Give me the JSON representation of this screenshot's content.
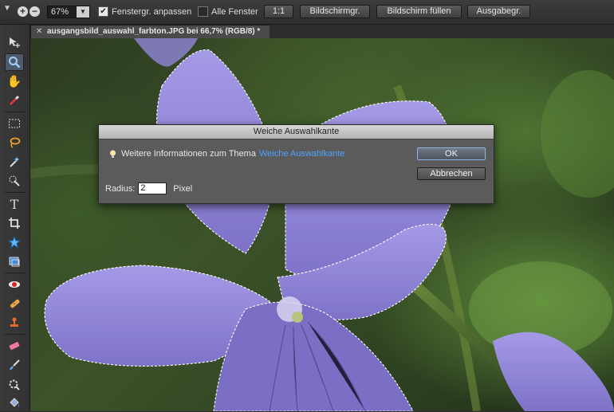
{
  "options_bar": {
    "zoom_value": "67%",
    "checkbox_resize": {
      "label": "Fenstergr. anpassen",
      "checked": true
    },
    "checkbox_all": {
      "label": "Alle Fenster",
      "checked": false
    },
    "buttons": {
      "actual_pixels": "1:1",
      "fit_screen": "Bildschirmgr.",
      "fill_screen": "Bildschirm füllen",
      "print_size": "Ausgabegr."
    }
  },
  "document_tab": {
    "title": "ausgangsbild_auswahl_farbton.JPG bei 66,7% (RGB/8) *"
  },
  "toolbox": {
    "tools": [
      "move-icon",
      "zoom-icon",
      "hand-icon",
      "eyedropper-icon",
      "marquee-icon",
      "lasso-icon",
      "magic-wand-icon",
      "quick-selection-icon",
      "type-icon",
      "crop-icon",
      "cookie-cutter-icon",
      "straighten-icon",
      "red-eye-icon",
      "healing-brush-icon",
      "clone-stamp-icon",
      "eraser-icon",
      "brush-icon",
      "smart-brush-icon",
      "paint-bucket-icon"
    ],
    "active_tool": "zoom-icon"
  },
  "dialog": {
    "title": "Weiche Auswahlkante",
    "info_text": "Weitere Informationen zum Thema",
    "info_link": "Weiche Auswahlkante",
    "ok_label": "OK",
    "cancel_label": "Abbrechen",
    "radius_label": "Radius:",
    "radius_value": "2",
    "radius_unit": "Pixel"
  },
  "colors": {
    "link": "#4da3ff",
    "petal": "#8f86d6",
    "foliage": "#3f5a2b"
  }
}
